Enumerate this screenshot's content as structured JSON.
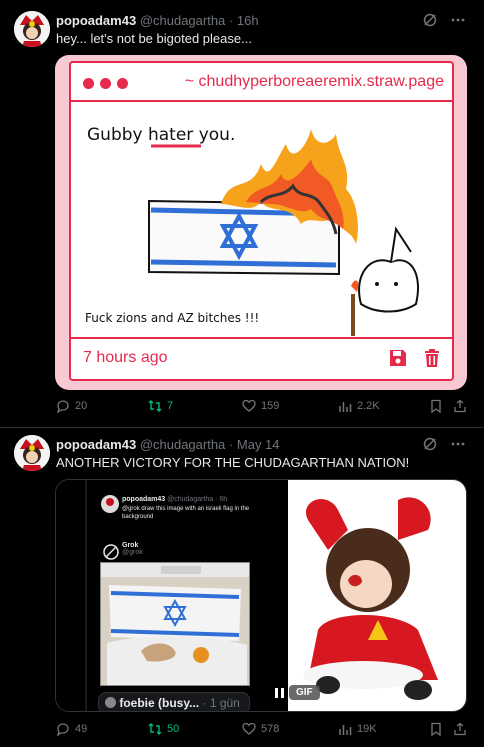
{
  "posts": [
    {
      "author": "popoadam43",
      "handle": "@chudagartha",
      "separator": "·",
      "time": "16h",
      "text": "hey... let's not be bigoted please...",
      "card": {
        "url": "~ chudhyperboreaeremix.straw.page",
        "drawing_caption_top": "Gubby hater you.",
        "drawing_caption_bottom": "Fuck zions and AZ bitches !!!",
        "time_ago": "7 hours ago"
      },
      "actions": {
        "replies": "20",
        "reposts": "7",
        "likes": "159",
        "views": "2.2K"
      }
    },
    {
      "author": "popoadam43",
      "handle": "@chudagartha",
      "separator": "·",
      "time": "May 14",
      "text": "ANOTHER VICTORY FOR THE CHUDAGARTHAN NATION!",
      "embedded": {
        "author": "popoadam43",
        "handle": "@chudagartha · 6h",
        "text": "@grok draw this image with an israeli flag in the background",
        "grok_name": "Grok",
        "grok_handle": "@grok",
        "reply_chip_name": "foebie (busy...",
        "reply_chip_time": "· 1 gün"
      },
      "gif_label": "GIF",
      "actions": {
        "replies": "49",
        "reposts": "50",
        "likes": "578",
        "views": "19K"
      }
    }
  ],
  "colors": {
    "accent_red": "#e62a4c",
    "repost_green": "#00ba7c",
    "muted": "#71767b",
    "flag_blue": "#2f6fd6"
  }
}
